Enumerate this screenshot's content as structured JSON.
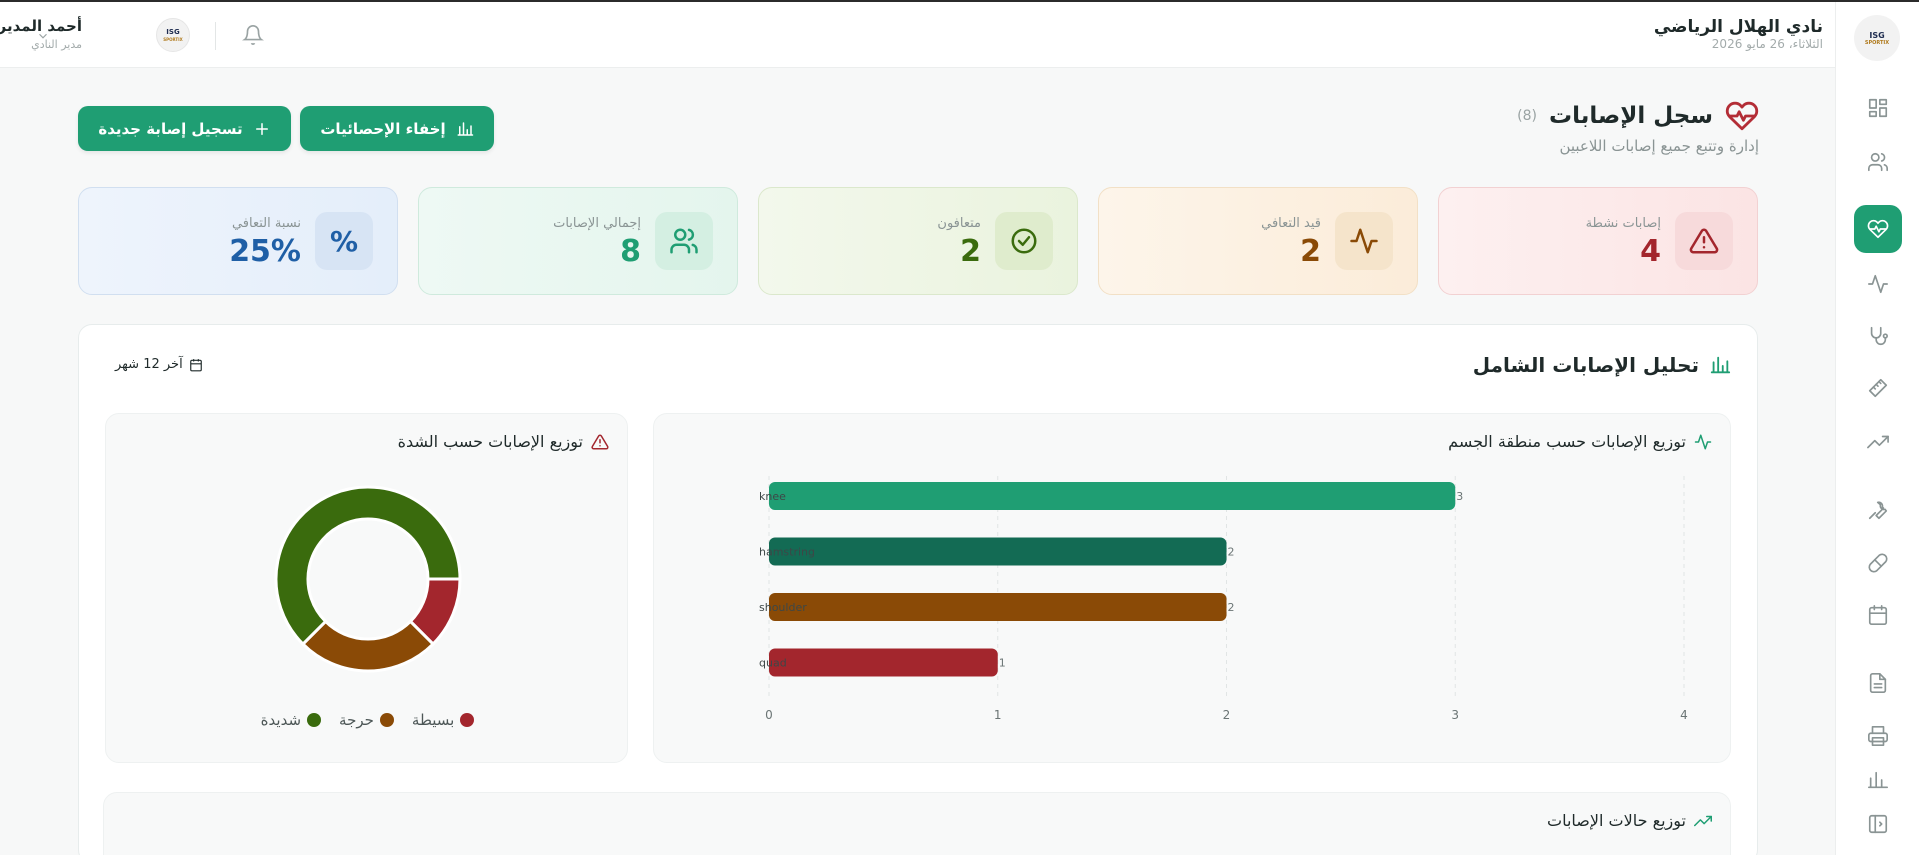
{
  "header": {
    "club_name": "نادي الهلال الرياضي",
    "club_date": "الثلاثاء، 26 مايو 2026",
    "user_name": "أحمد المدير",
    "user_role": "مدير النادي",
    "logo_text": "ISG",
    "logo_sub": "SPORTIX"
  },
  "page": {
    "title": "سجل الإصابات",
    "count": "(8)",
    "subtitle": "إدارة وتتبع جميع إصابات اللاعبين",
    "add_button": "تسجيل إصابة جديدة",
    "hide_stats_button": "إخفاء الإحصائيات"
  },
  "stats": [
    {
      "label": "إصابات نشطة",
      "value": "4",
      "color": "#a3262d"
    },
    {
      "label": "قيد التعافي",
      "value": "2",
      "color": "#8a4a06"
    },
    {
      "label": "متعافون",
      "value": "2",
      "color": "#3a6b0d"
    },
    {
      "label": "إجمالي الإصابات",
      "value": "8",
      "color": "#1f9e73"
    },
    {
      "label": "نسبة التعافي",
      "value": "25%",
      "color": "#1f5fa6",
      "icon_text": "%"
    }
  ],
  "analysis": {
    "title": "تحليل الإصابات الشامل",
    "period": "آخر 12 شهر",
    "body_chart_title": "توزيع الإصابات حسب منطقة الجسم",
    "severity_chart_title": "توزيع الإصابات حسب الشدة",
    "status_chart_title": "توزيع حالات الإصابات"
  },
  "chart_data": [
    {
      "type": "bar",
      "orientation": "horizontal",
      "title": "توزيع الإصابات حسب منطقة الجسم",
      "categories": [
        "knee",
        "hamstring",
        "shoulder",
        "quad"
      ],
      "values": [
        3,
        2,
        2,
        1
      ],
      "colors": [
        "#1f9e73",
        "#136b54",
        "#8a4a06",
        "#a3262d"
      ],
      "xlim": [
        0,
        4
      ],
      "xticks": [
        "0",
        "1",
        "2",
        "3",
        "4"
      ],
      "grid": true
    },
    {
      "type": "pie",
      "donut": true,
      "title": "توزيع الإصابات حسب الشدة",
      "categories": [
        "بسيطة",
        "حرجة",
        "شديدة"
      ],
      "values": [
        1,
        2,
        5
      ],
      "colors": [
        "#a3262d",
        "#8a4a06",
        "#3a6b0d"
      ],
      "legend": "bottom"
    }
  ],
  "icons": {
    "sidebar": [
      "dashboard-icon",
      "users-icon",
      "heart-pulse-icon",
      "activity-icon",
      "stethoscope-icon",
      "ruler-icon",
      "trend-icon",
      "wrench-icon",
      "pill-icon",
      "calendar-icon",
      "document-icon",
      "printer-icon",
      "chart-icon",
      "collapse-icon"
    ]
  }
}
